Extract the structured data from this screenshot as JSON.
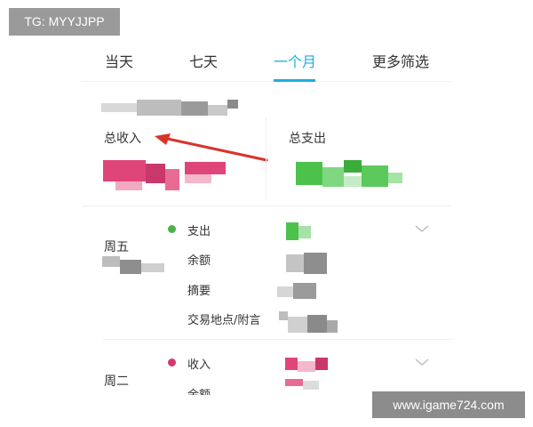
{
  "badge": {
    "text": "TG: MYYJJPP"
  },
  "tabs": [
    {
      "label": "当天",
      "active": false
    },
    {
      "label": "七天",
      "active": false
    },
    {
      "label": "一个月",
      "active": true
    },
    {
      "label": "更多筛选",
      "active": false
    }
  ],
  "summary": {
    "income_label": "总收入",
    "expense_label": "总支出"
  },
  "transactions": [
    {
      "day": "周五",
      "type_label": "支出",
      "type_color": "#4bb34b",
      "fields": [
        "余额",
        "摘要",
        "交易地点/附言"
      ]
    },
    {
      "day": "周二",
      "type_label": "收入",
      "type_color": "#d6386a",
      "fields": [
        "余额"
      ]
    }
  ],
  "colors": {
    "accent": "#1eaedf",
    "income": "#e0457a",
    "expense": "#4cc24c",
    "annotation_arrow": "#d9332b"
  },
  "watermark": {
    "text": "www.igame724.com"
  }
}
